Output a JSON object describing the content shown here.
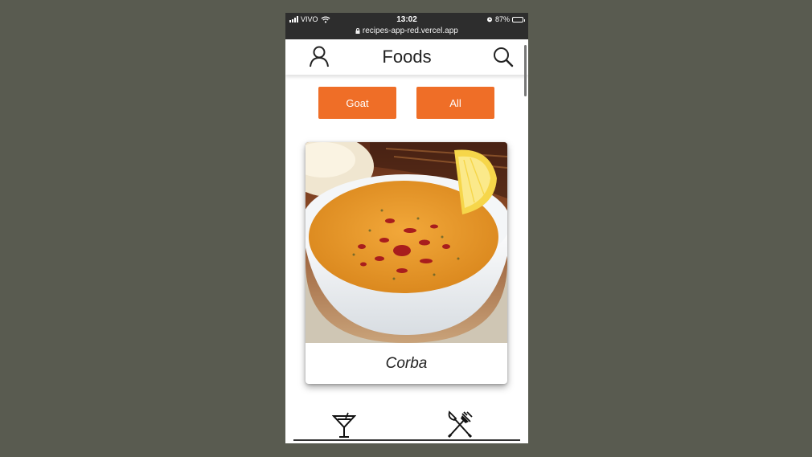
{
  "status_bar": {
    "carrier": "VIVO",
    "time": "13:02",
    "battery_percent": "87%",
    "battery_level": 0.87,
    "url": "recipes-app-red.vercel.app"
  },
  "header": {
    "title": "Foods",
    "left_icon": "user-icon",
    "right_icon": "search-icon"
  },
  "filters": [
    {
      "label": "Goat"
    },
    {
      "label": "All"
    }
  ],
  "recipes": [
    {
      "name": "Corba"
    }
  ],
  "bottom_nav": {
    "items": [
      {
        "icon": "drink-icon"
      },
      {
        "icon": "fork-knife-icon"
      }
    ]
  },
  "colors": {
    "accent": "#ef6e27",
    "status_bar_bg": "#2d2d2d",
    "page_bg": "#595b50"
  }
}
